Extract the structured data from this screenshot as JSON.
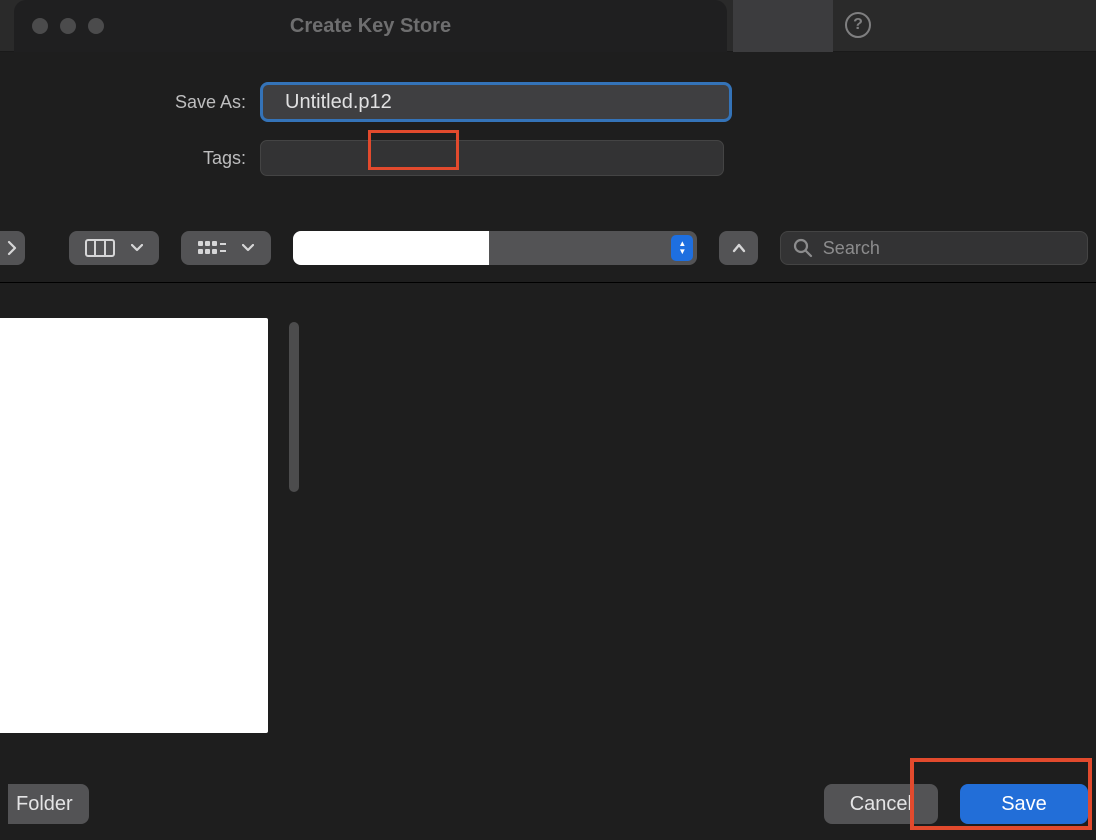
{
  "window": {
    "title": "Create Key Store"
  },
  "form": {
    "save_as_label": "Save As:",
    "filename": "Untitled.p12",
    "tags_label": "Tags:"
  },
  "toolbar": {
    "search_placeholder": "Search"
  },
  "footer": {
    "new_folder_label": "Folder",
    "cancel_label": "Cancel",
    "save_label": "Save"
  }
}
